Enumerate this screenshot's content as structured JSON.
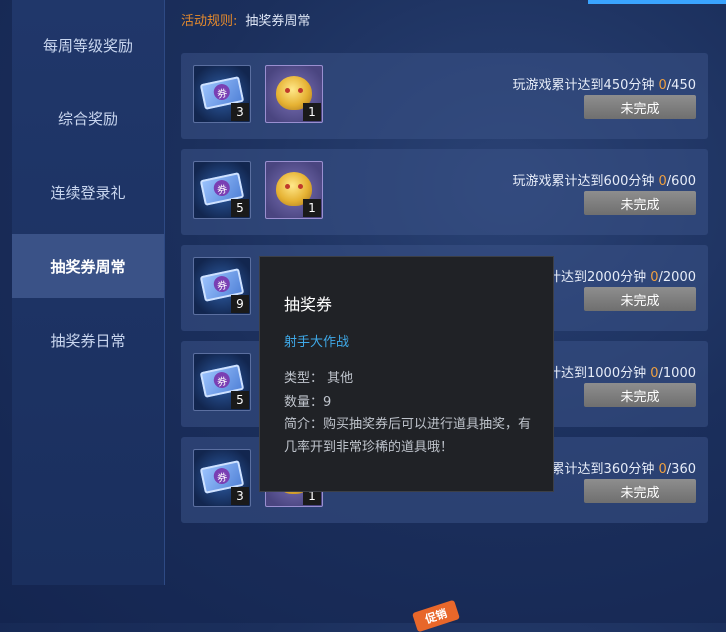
{
  "sidebar": {
    "items": [
      {
        "label": "每周等级奖励"
      },
      {
        "label": "综合奖励"
      },
      {
        "label": "连续登录礼"
      },
      {
        "label": "抽奖券周常"
      },
      {
        "label": "抽奖券日常"
      }
    ],
    "active_index": 3
  },
  "rules": {
    "key": "活动规则:",
    "value": "抽奖券周常"
  },
  "rows": [
    {
      "ticket_count": "3",
      "gift_count": "1",
      "condition": "玩游戏累计达到450分钟",
      "current": "0",
      "target": "/450",
      "status": "未完成"
    },
    {
      "ticket_count": "5",
      "gift_count": "1",
      "condition": "玩游戏累计达到600分钟",
      "current": "0",
      "target": "/600",
      "status": "未完成"
    },
    {
      "ticket_count": "9",
      "gift_count": "",
      "condition": "计达到2000分钟",
      "current": "0",
      "target": "/2000",
      "status": "未完成"
    },
    {
      "ticket_count": "5",
      "gift_count": "",
      "condition": "计达到1000分钟",
      "current": "0",
      "target": "/1000",
      "status": "未完成"
    },
    {
      "ticket_count": "3",
      "gift_count": "1",
      "condition": "累计达到360分钟",
      "current": "0",
      "target": "/360",
      "status": "未完成"
    }
  ],
  "ticket_glyph": "券",
  "tooltip": {
    "title": "抽奖券",
    "source": "射手大作战",
    "type_line": "类型：  其他",
    "qty_line": "数量：9",
    "desc": "简介：购买抽奖券后可以进行道具抽奖，有几率开到非常珍稀的道具哦！"
  },
  "sale_badge": "促销"
}
